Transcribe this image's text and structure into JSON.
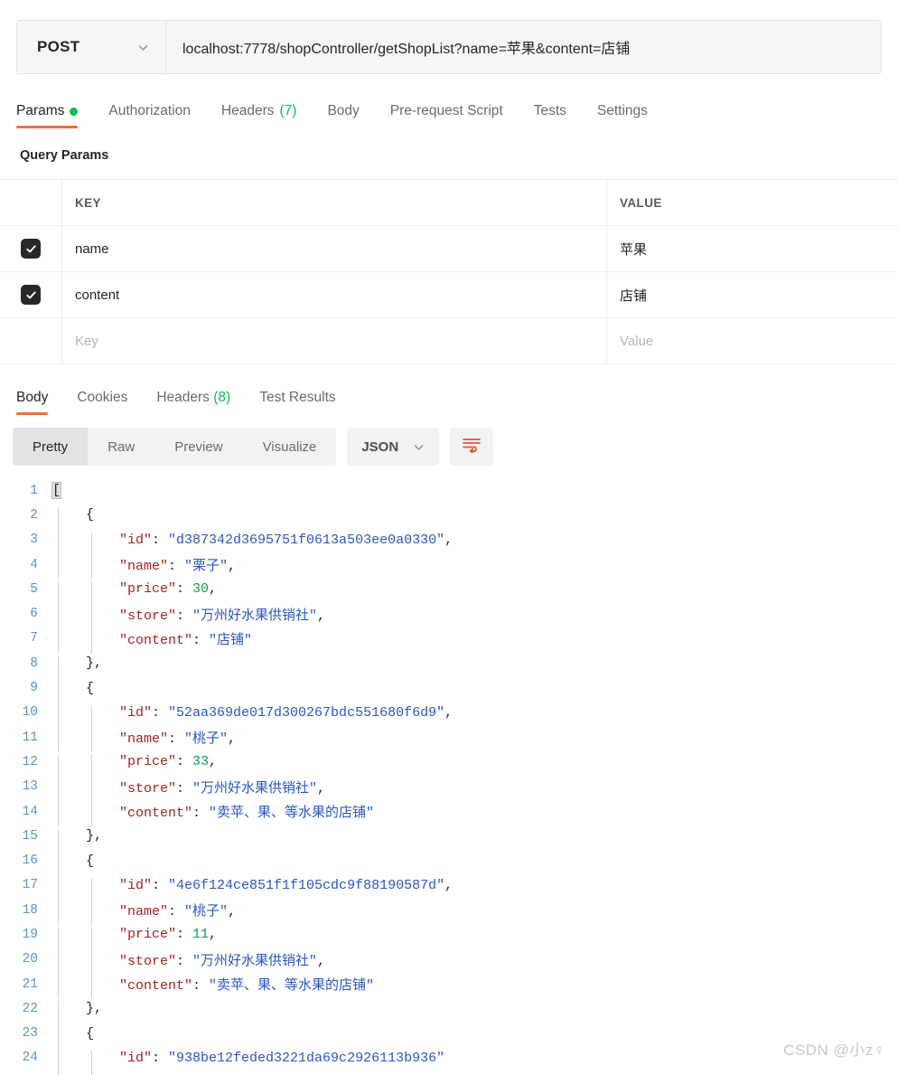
{
  "request": {
    "method": "POST",
    "url": "localhost:7778/shopController/getShopList?name=苹果&content=店铺",
    "tabs": [
      {
        "label": "Params",
        "badge_dot": true,
        "active": true
      },
      {
        "label": "Authorization",
        "active": false
      },
      {
        "label": "Headers",
        "count": "(7)",
        "active": false
      },
      {
        "label": "Body",
        "active": false
      },
      {
        "label": "Pre-request Script",
        "active": false
      },
      {
        "label": "Tests",
        "active": false
      },
      {
        "label": "Settings",
        "active": false
      }
    ],
    "query_params_title": "Query Params",
    "table": {
      "headers": {
        "key": "KEY",
        "value": "VALUE"
      },
      "rows": [
        {
          "checked": true,
          "key": "name",
          "value": "苹果"
        },
        {
          "checked": true,
          "key": "content",
          "value": "店铺"
        }
      ],
      "empty_row": {
        "key_placeholder": "Key",
        "value_placeholder": "Value"
      }
    }
  },
  "response": {
    "tabs": [
      {
        "label": "Body",
        "active": true
      },
      {
        "label": "Cookies",
        "active": false
      },
      {
        "label": "Headers",
        "count": "(8)",
        "active": false
      },
      {
        "label": "Test Results",
        "active": false
      }
    ],
    "view_modes": [
      {
        "label": "Pretty",
        "active": true
      },
      {
        "label": "Raw",
        "active": false
      },
      {
        "label": "Preview",
        "active": false
      },
      {
        "label": "Visualize",
        "active": false
      }
    ],
    "format": "JSON",
    "wrap_icon": "wrap-lines-icon",
    "body_lines": [
      {
        "n": 1,
        "indent": 0,
        "guides": 0,
        "tokens": [
          {
            "t": "[",
            "c": "p bracket-hl"
          }
        ]
      },
      {
        "n": 2,
        "indent": 1,
        "guides": 1,
        "tokens": [
          {
            "t": "{",
            "c": "p"
          }
        ]
      },
      {
        "n": 3,
        "indent": 2,
        "guides": 2,
        "tokens": [
          {
            "t": "\"id\"",
            "c": "k"
          },
          {
            "t": ": ",
            "c": "p"
          },
          {
            "t": "\"d387342d3695751f0613a503ee0a0330\"",
            "c": "s"
          },
          {
            "t": ",",
            "c": "p"
          }
        ]
      },
      {
        "n": 4,
        "indent": 2,
        "guides": 2,
        "tokens": [
          {
            "t": "\"name\"",
            "c": "k"
          },
          {
            "t": ": ",
            "c": "p"
          },
          {
            "t": "\"栗子\"",
            "c": "s"
          },
          {
            "t": ",",
            "c": "p"
          }
        ]
      },
      {
        "n": 5,
        "indent": 2,
        "guides": 2,
        "tokens": [
          {
            "t": "\"price\"",
            "c": "k"
          },
          {
            "t": ": ",
            "c": "p"
          },
          {
            "t": "30",
            "c": "n"
          },
          {
            "t": ",",
            "c": "p"
          }
        ]
      },
      {
        "n": 6,
        "indent": 2,
        "guides": 2,
        "tokens": [
          {
            "t": "\"store\"",
            "c": "k"
          },
          {
            "t": ": ",
            "c": "p"
          },
          {
            "t": "\"万州好水果供销社\"",
            "c": "s"
          },
          {
            "t": ",",
            "c": "p"
          }
        ]
      },
      {
        "n": 7,
        "indent": 2,
        "guides": 2,
        "tokens": [
          {
            "t": "\"content\"",
            "c": "k"
          },
          {
            "t": ": ",
            "c": "p"
          },
          {
            "t": "\"店铺\"",
            "c": "s"
          }
        ]
      },
      {
        "n": 8,
        "indent": 1,
        "guides": 1,
        "tokens": [
          {
            "t": "}",
            "c": "p"
          },
          {
            "t": ",",
            "c": "p"
          }
        ]
      },
      {
        "n": 9,
        "indent": 1,
        "guides": 1,
        "tokens": [
          {
            "t": "{",
            "c": "p"
          }
        ]
      },
      {
        "n": 10,
        "indent": 2,
        "guides": 2,
        "tokens": [
          {
            "t": "\"id\"",
            "c": "k"
          },
          {
            "t": ": ",
            "c": "p"
          },
          {
            "t": "\"52aa369de017d300267bdc551680f6d9\"",
            "c": "s"
          },
          {
            "t": ",",
            "c": "p"
          }
        ]
      },
      {
        "n": 11,
        "indent": 2,
        "guides": 2,
        "tokens": [
          {
            "t": "\"name\"",
            "c": "k"
          },
          {
            "t": ": ",
            "c": "p"
          },
          {
            "t": "\"桃子\"",
            "c": "s"
          },
          {
            "t": ",",
            "c": "p"
          }
        ]
      },
      {
        "n": 12,
        "indent": 2,
        "guides": 2,
        "tokens": [
          {
            "t": "\"price\"",
            "c": "k"
          },
          {
            "t": ": ",
            "c": "p"
          },
          {
            "t": "33",
            "c": "n"
          },
          {
            "t": ",",
            "c": "p"
          }
        ]
      },
      {
        "n": 13,
        "indent": 2,
        "guides": 2,
        "tokens": [
          {
            "t": "\"store\"",
            "c": "k"
          },
          {
            "t": ": ",
            "c": "p"
          },
          {
            "t": "\"万州好水果供销社\"",
            "c": "s"
          },
          {
            "t": ",",
            "c": "p"
          }
        ]
      },
      {
        "n": 14,
        "indent": 2,
        "guides": 2,
        "tokens": [
          {
            "t": "\"content\"",
            "c": "k"
          },
          {
            "t": ": ",
            "c": "p"
          },
          {
            "t": "\"卖苹、果、等水果的店铺\"",
            "c": "s"
          }
        ]
      },
      {
        "n": 15,
        "indent": 1,
        "guides": 1,
        "tokens": [
          {
            "t": "}",
            "c": "p"
          },
          {
            "t": ",",
            "c": "p"
          }
        ]
      },
      {
        "n": 16,
        "indent": 1,
        "guides": 1,
        "tokens": [
          {
            "t": "{",
            "c": "p"
          }
        ]
      },
      {
        "n": 17,
        "indent": 2,
        "guides": 2,
        "tokens": [
          {
            "t": "\"id\"",
            "c": "k"
          },
          {
            "t": ": ",
            "c": "p"
          },
          {
            "t": "\"4e6f124ce851f1f105cdc9f88190587d\"",
            "c": "s"
          },
          {
            "t": ",",
            "c": "p"
          }
        ]
      },
      {
        "n": 18,
        "indent": 2,
        "guides": 2,
        "tokens": [
          {
            "t": "\"name\"",
            "c": "k"
          },
          {
            "t": ": ",
            "c": "p"
          },
          {
            "t": "\"桃子\"",
            "c": "s"
          },
          {
            "t": ",",
            "c": "p"
          }
        ]
      },
      {
        "n": 19,
        "indent": 2,
        "guides": 2,
        "tokens": [
          {
            "t": "\"price\"",
            "c": "k"
          },
          {
            "t": ": ",
            "c": "p"
          },
          {
            "t": "11",
            "c": "n"
          },
          {
            "t": ",",
            "c": "p"
          }
        ]
      },
      {
        "n": 20,
        "indent": 2,
        "guides": 2,
        "tokens": [
          {
            "t": "\"store\"",
            "c": "k"
          },
          {
            "t": ": ",
            "c": "p"
          },
          {
            "t": "\"万州好水果供销社\"",
            "c": "s"
          },
          {
            "t": ",",
            "c": "p"
          }
        ]
      },
      {
        "n": 21,
        "indent": 2,
        "guides": 2,
        "tokens": [
          {
            "t": "\"content\"",
            "c": "k"
          },
          {
            "t": ": ",
            "c": "p"
          },
          {
            "t": "\"卖苹、果、等水果的店铺\"",
            "c": "s"
          }
        ]
      },
      {
        "n": 22,
        "indent": 1,
        "guides": 1,
        "tokens": [
          {
            "t": "}",
            "c": "p"
          },
          {
            "t": ",",
            "c": "p"
          }
        ]
      },
      {
        "n": 23,
        "indent": 1,
        "guides": 1,
        "tokens": [
          {
            "t": "{",
            "c": "p"
          }
        ]
      },
      {
        "n": 24,
        "indent": 2,
        "guides": 2,
        "tokens": [
          {
            "t": "\"id\"",
            "c": "k"
          },
          {
            "t": ": ",
            "c": "p"
          },
          {
            "t": "\"938be12feded3221da69c2926113b936\"",
            "c": "s"
          }
        ]
      }
    ]
  },
  "watermark": "CSDN @小z♀"
}
